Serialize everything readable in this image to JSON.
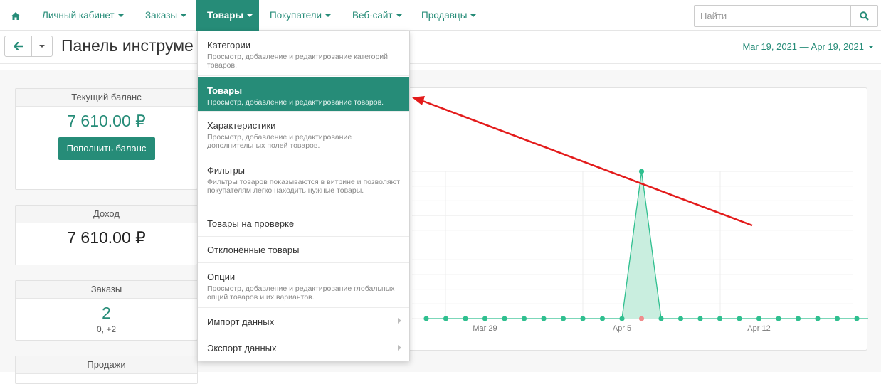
{
  "nav": {
    "items": [
      {
        "label": "Личный кабинет"
      },
      {
        "label": "Заказы"
      },
      {
        "label": "Товары"
      },
      {
        "label": "Покупатели"
      },
      {
        "label": "Веб-сайт"
      },
      {
        "label": "Продавцы"
      }
    ],
    "search_placeholder": "Найти"
  },
  "toolbar": {
    "title": "Панель инструме",
    "date_range": "Mar 19, 2021 — Apr 19, 2021"
  },
  "widgets": {
    "balance": {
      "title": "Текущий баланс",
      "value": "7 610.00 ₽",
      "button": "Пополнить баланс"
    },
    "income": {
      "title": "Доход",
      "value": "7 610.00 ₽"
    },
    "orders": {
      "title": "Заказы",
      "value": "2",
      "sub": "0, +2"
    },
    "sales": {
      "title": "Продажи"
    }
  },
  "dropdown": {
    "items": [
      {
        "title": "Категории",
        "desc": "Просмотр, добавление и редактирование категорий товаров."
      },
      {
        "title": "Товары",
        "desc": "Просмотр, добавление и редактирование товаров."
      },
      {
        "title": "Характеристики",
        "desc": "Просмотр, добавление и редактирование дополнительных полей товаров."
      },
      {
        "title": "Фильтры",
        "desc": "Фильтры товаров показываются в витрине и позволяют покупателям легко находить нужные товары."
      },
      {
        "title": "Товары на проверке",
        "desc": ""
      },
      {
        "title": "Отклонённые товары",
        "desc": ""
      },
      {
        "title": "Опции",
        "desc": "Просмотр, добавление и редактирование глобальных опций товаров и их вариантов."
      },
      {
        "title": "Импорт данных",
        "desc": ""
      },
      {
        "title": "Экспорт данных",
        "desc": ""
      }
    ]
  },
  "chart_data": {
    "type": "area",
    "x_tick_labels": [
      "Mar 29",
      "Apr 5",
      "Apr 12"
    ],
    "x_visible_start_index": 0,
    "series": [
      {
        "values": [
          0,
          0,
          0,
          0,
          0,
          0,
          0,
          0,
          0,
          0,
          0,
          0,
          0,
          0,
          0,
          0,
          0,
          0,
          0,
          0,
          0,
          0,
          0,
          0
        ],
        "color": "#2fbf8f"
      }
    ],
    "secondary_series": [
      {
        "values": [
          0,
          0,
          0,
          0,
          0,
          0,
          0,
          0,
          0,
          0,
          0,
          0,
          0,
          0,
          0,
          0,
          0,
          0,
          0,
          0,
          0,
          0,
          0,
          0
        ],
        "color": "#f08c8c"
      }
    ],
    "peak_index": 11,
    "peak_value": 1,
    "ylim": [
      0,
      1.2
    ],
    "colors": {
      "line": "#2fbf8f",
      "fill": "#c9eedf",
      "grid": "#ececec",
      "red": "#f08c8c"
    }
  },
  "colors": {
    "accent": "#268c78",
    "annotation": "#e31b1b"
  }
}
